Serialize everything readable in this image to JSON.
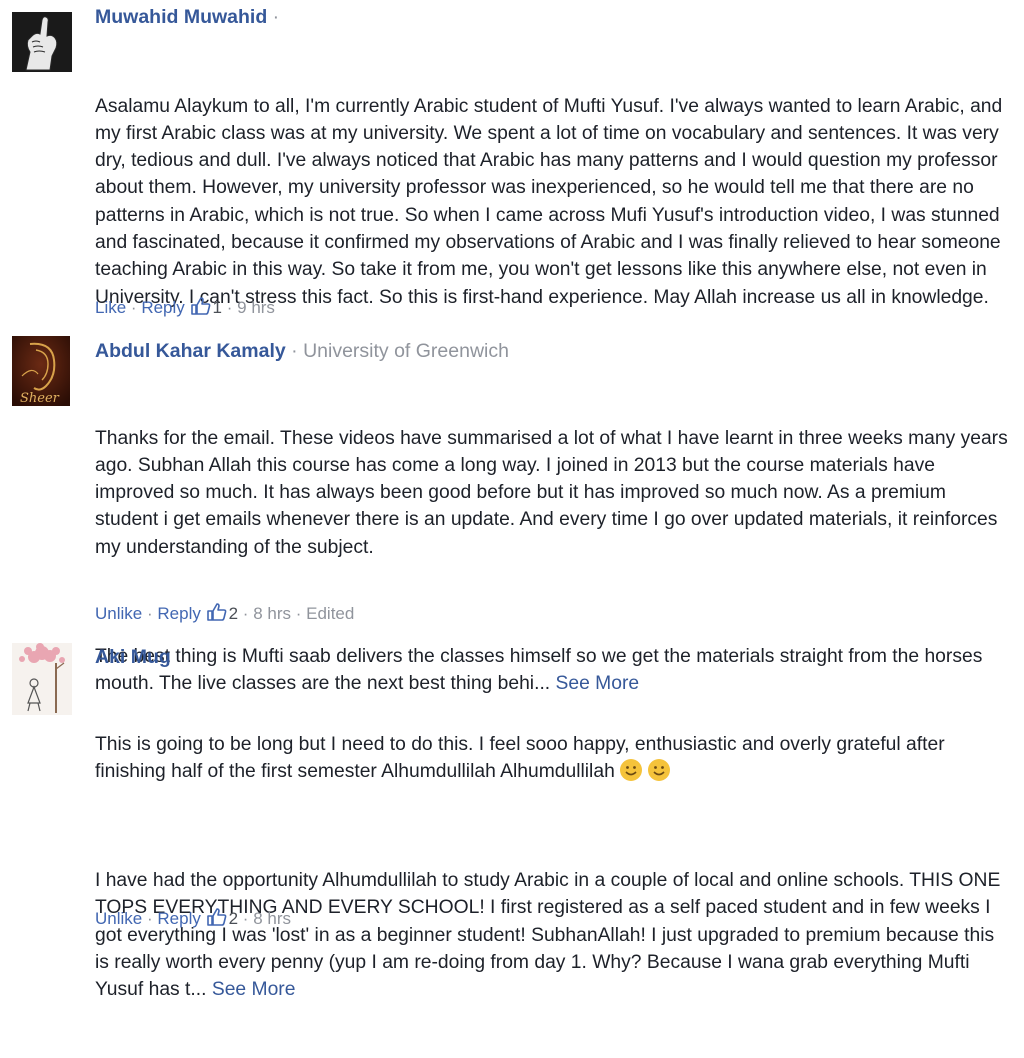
{
  "comments": [
    {
      "author": "Muwahid Muwahid",
      "affiliation": "",
      "paragraphs": [
        "Asalamu Alaykum to all, I'm currently Arabic student of Mufti Yusuf. I've always wanted to learn Arabic, and my first Arabic class was at my university. We spent a lot of time on vocabulary and sentences. It was very dry, tedious and dull. I've always noticed that Arabic has many patterns and I would question my professor about them. However, my university professor was inexperienced, so he would tell me that there are no patterns in Arabic, which is not true. So when I came across Mufi Yusuf's introduction video, I was stunned and fascinated, because it confirmed my observations of Arabic and I was finally relieved to hear someone teaching Arabic in this way. So take it from me, you won't get lessons like this anywhere else, not even in University. I can't stress this fact. So this is first-hand experience. May Allah increase us all in knowledge."
      ],
      "see_more": "",
      "actions": {
        "like": "Like",
        "reply": "Reply",
        "likes": "1",
        "time": "9 hrs",
        "edited": ""
      },
      "avatar_icon": "raised-fist-icon"
    },
    {
      "author": "Abdul Kahar Kamaly",
      "affiliation": "University of Greenwich",
      "paragraphs": [
        "Thanks for the email. These videos have summarised a lot of what I have learnt in three weeks many years ago. Subhan Allah this course has come a long way. I joined in 2013 but the course materials have improved so much. It has always been good before but it has improved so much now. As a premium student i get emails whenever there is an update. And every time I go over updated materials, it reinforces my understanding of the subject.",
        "The best thing is Mufti saab delivers the classes himself so we get the materials straight from the horses mouth. The live classes are the next best thing behi..."
      ],
      "see_more": "See More",
      "actions": {
        "like": "Unlike",
        "reply": "Reply",
        "likes": "2",
        "time": "8 hrs",
        "edited": "Edited"
      },
      "avatar_icon": "calligraphy-portrait-icon",
      "avatar_text": "Sheer"
    },
    {
      "author": "Aki Mug",
      "affiliation": "",
      "paragraphs": [
        "This is going to be long but I need to do this. I feel sooo happy, enthusiastic and overly grateful after finishing half of the first semester Alhumdullilah Alhumdullilah",
        "I have had the opportunity Alhumdullilah to study Arabic in a couple of local and online schools. THIS ONE TOPS EVERYTHING AND EVERY SCHOOL! I first registered as a self paced student and in few weeks I got everything I was 'lost' in as a beginner student! SubhanAllah! I just upgraded to premium because this is really worth every penny (yup I am re-doing from day 1. Why? Because I wana grab everything Mufti Yusuf has t..."
      ],
      "see_more": "See More",
      "actions": {
        "like": "Unlike",
        "reply": "Reply",
        "likes": "2",
        "time": "8 hrs",
        "edited": ""
      },
      "avatar_icon": "tree-figure-icon",
      "emoji_icon": "smiley-emoji-icon"
    }
  ],
  "separator": "·"
}
